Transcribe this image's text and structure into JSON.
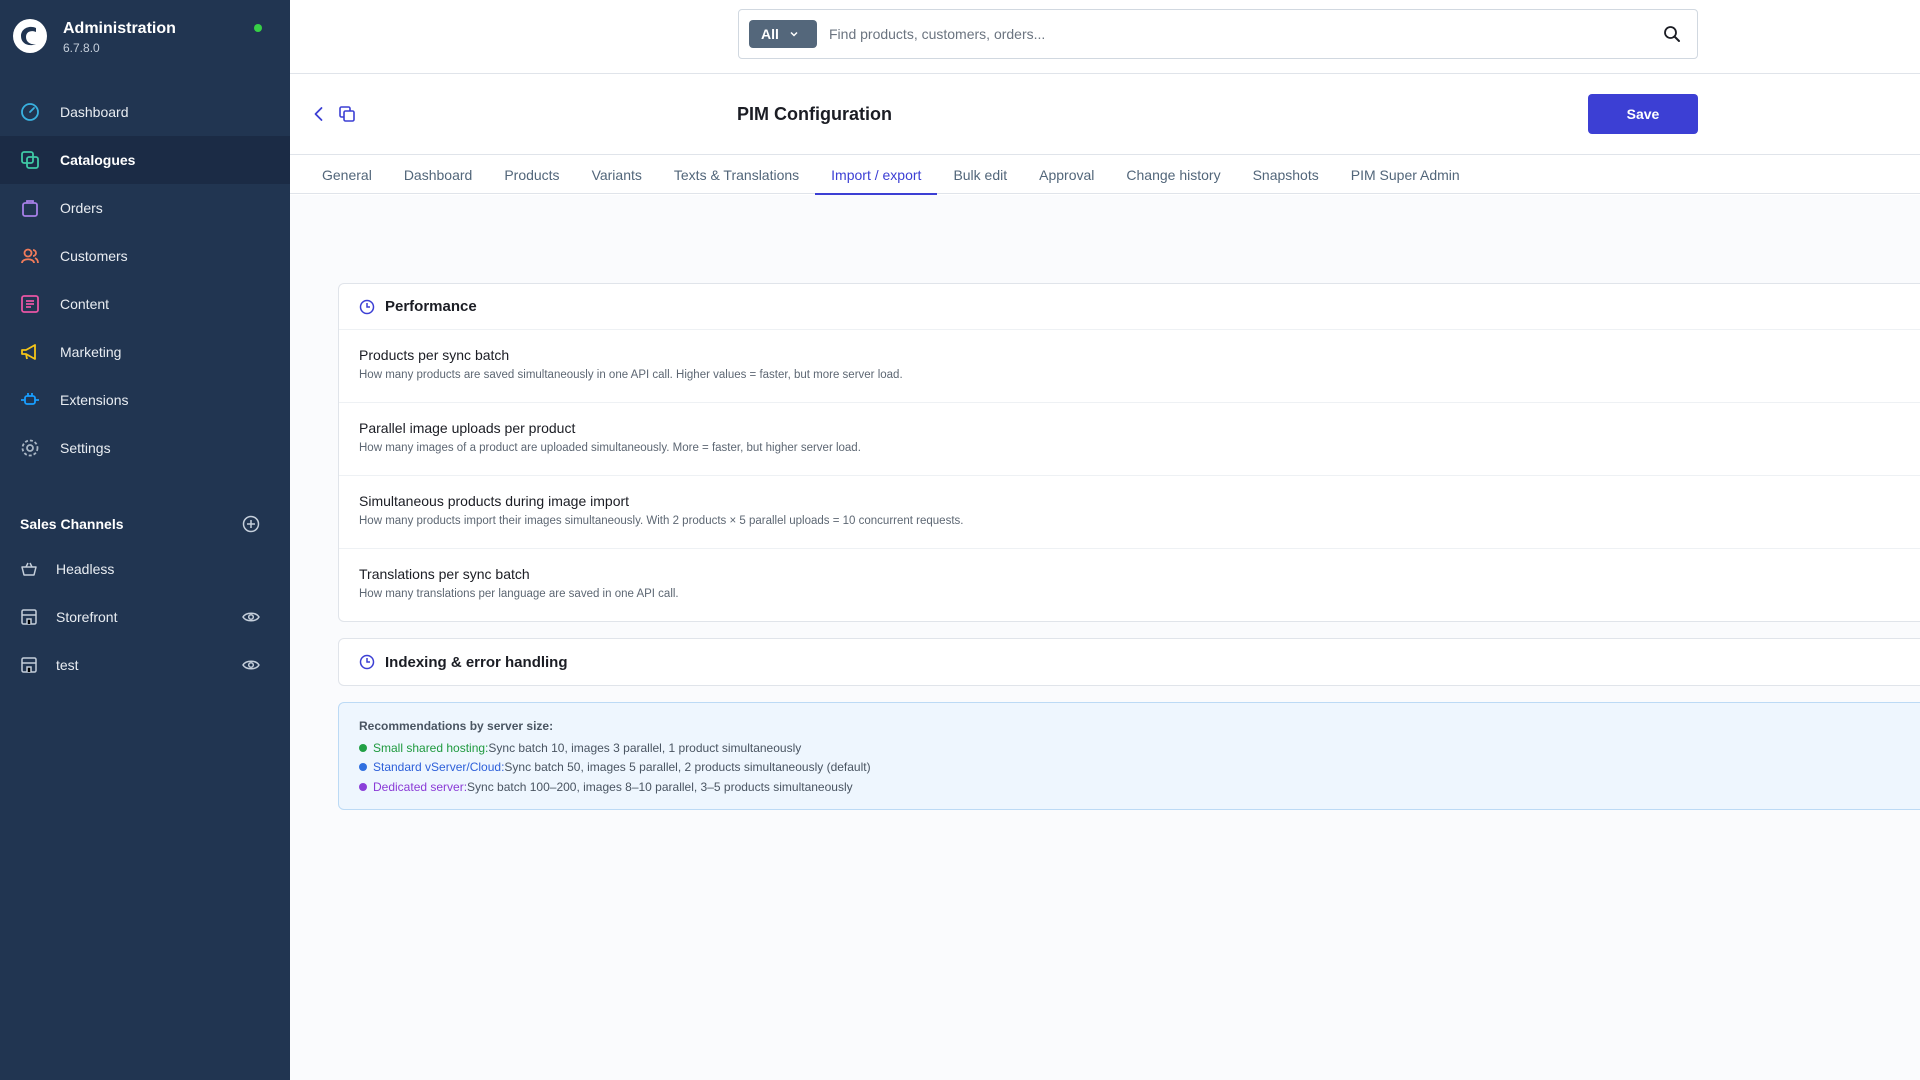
{
  "brand": {
    "title": "Administration",
    "version": "6.7.8.0"
  },
  "nav": [
    {
      "label": "Dashboard",
      "icon": "dashboard-icon"
    },
    {
      "label": "Catalogues",
      "icon": "catalogues-icon"
    },
    {
      "label": "Orders",
      "icon": "orders-icon"
    },
    {
      "label": "Customers",
      "icon": "customers-icon"
    },
    {
      "label": "Content",
      "icon": "content-icon"
    },
    {
      "label": "Marketing",
      "icon": "marketing-icon"
    },
    {
      "label": "Extensions",
      "icon": "extensions-icon"
    },
    {
      "label": "Settings",
      "icon": "settings-icon"
    }
  ],
  "active_nav": "Catalogues",
  "sales_channels": {
    "title": "Sales Channels",
    "items": [
      {
        "label": "Headless"
      },
      {
        "label": "Storefront"
      },
      {
        "label": "test"
      }
    ]
  },
  "search": {
    "type": "All",
    "placeholder": "Find products, customers, orders..."
  },
  "page": {
    "title": "PIM Configuration",
    "save_label": "Save"
  },
  "tabs": [
    "General",
    "Dashboard",
    "Products",
    "Variants",
    "Texts & Translations",
    "Import / export",
    "Bulk edit",
    "Approval",
    "Change history",
    "Snapshots",
    "PIM Super Admin"
  ],
  "active_tab": "Import / export",
  "performance": {
    "title": "Performance",
    "rows": [
      {
        "title": "Products per sync batch",
        "desc": "How many products are saved simultaneously in one API call. Higher values = faster, but more server load."
      },
      {
        "title": "Parallel image uploads per product",
        "desc": "How many images of a product are uploaded simultaneously. More = faster, but higher server load."
      },
      {
        "title": "Simultaneous products during image import",
        "desc": "How many products import their images simultaneously. With 2 products × 5 parallel uploads = 10 concurrent requests."
      },
      {
        "title": "Translations per sync batch",
        "desc": "How many translations per language are saved in one API call."
      }
    ]
  },
  "indexing": {
    "title": "Indexing & error handling"
  },
  "recommendations": {
    "title": "Recommendations by server size:",
    "items": [
      {
        "key": "Small shared hosting:",
        "text": "Sync batch 10, images 3 parallel, 1 product simultaneously",
        "color": "#22a045"
      },
      {
        "key": "Standard vServer/Cloud:",
        "text": "Sync batch 50, images 5 parallel, 2 products simultaneously (default)",
        "color": "#2f6fe0"
      },
      {
        "key": "Dedicated server:",
        "text": "Sync batch 100–200, images 8–10 parallel, 3–5 products simultaneously",
        "color": "#8b3fd9"
      }
    ]
  },
  "colors": {
    "sidebar": "#213551",
    "accent": "#3c3fd4",
    "status_online": "#37d046"
  }
}
